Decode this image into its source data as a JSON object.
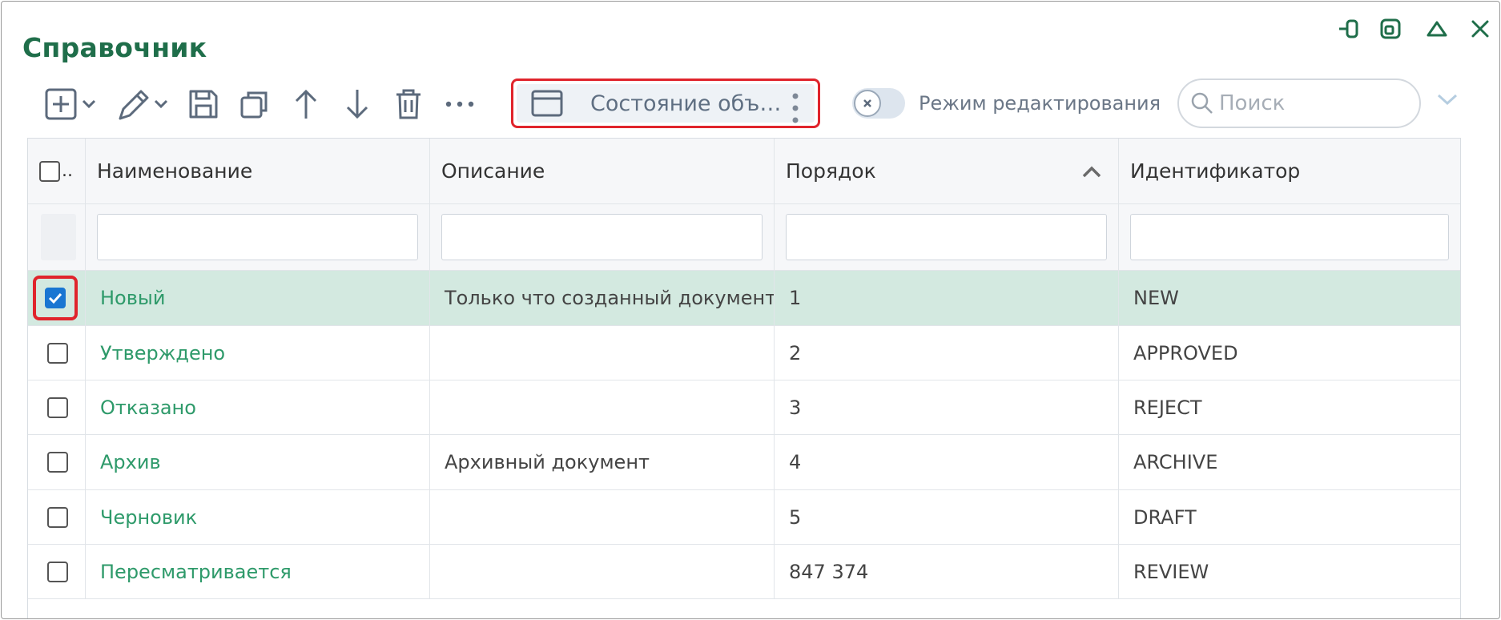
{
  "window": {
    "title": "Справочник"
  },
  "toolbar": {
    "object_selector_label": "Состояние объ…",
    "edit_mode_label": "Режим редактирования",
    "edit_mode_on": false
  },
  "search": {
    "placeholder": "Поиск",
    "value": ""
  },
  "table": {
    "select_all_suffix": "..",
    "columns": [
      "Наименование",
      "Описание",
      "Порядок",
      "Идентификатор"
    ],
    "sorted_column": "Порядок",
    "sort_direction": "asc",
    "rows": [
      {
        "name": "Новый",
        "description": "Только что созданный документ",
        "order": "1",
        "id": "NEW",
        "checked": true
      },
      {
        "name": "Утверждено",
        "description": "",
        "order": "2",
        "id": "APPROVED",
        "checked": false
      },
      {
        "name": "Отказано",
        "description": "",
        "order": "3",
        "id": "REJECT",
        "checked": false
      },
      {
        "name": "Архив",
        "description": "Архивный документ",
        "order": "4",
        "id": "ARCHIVE",
        "checked": false
      },
      {
        "name": "Черновик",
        "description": "",
        "order": "5",
        "id": "DRAFT",
        "checked": false
      },
      {
        "name": "Пересматривается",
        "description": "",
        "order": "847 374",
        "id": "REVIEW",
        "checked": false
      }
    ]
  },
  "colors": {
    "accent": "#1f6e4a",
    "link": "#2e9a6a",
    "selected_row": "#d3e9e0",
    "highlight": "#e0242c",
    "checkbox": "#1976d2"
  },
  "icons": {
    "window_controls": [
      "dock-icon",
      "restore-icon",
      "collapse-icon",
      "close-icon"
    ],
    "toolbar": [
      "add-icon",
      "edit-icon",
      "save-icon",
      "copy-icon",
      "arrow-up-icon",
      "arrow-down-icon",
      "delete-icon",
      "more-icon"
    ]
  }
}
